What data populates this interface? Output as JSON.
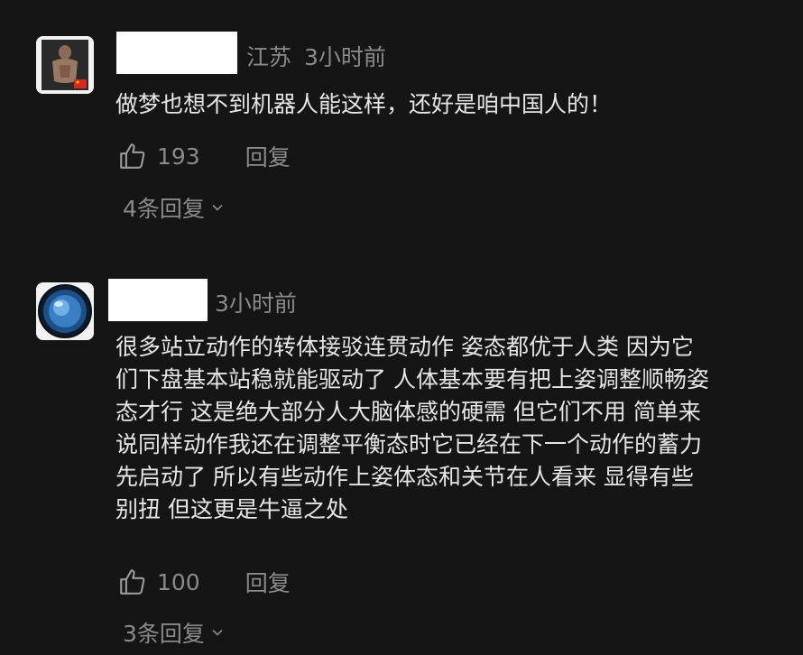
{
  "comments": [
    {
      "location": "江苏",
      "time": "3小时前",
      "text": "做梦也想不到机器人能这样，还好是咱中国人的！",
      "likes": "193",
      "reply_label": "回复",
      "more_replies": "4条回复"
    },
    {
      "location": "",
      "time": "3小时前",
      "text_lines": [
        "很多站立动作的转体接驳连贯动作 姿态都优于人类 因为它",
        "们下盘基本站稳就能驱动了 人体基本要有把上姿调整顺畅姿",
        "态才行 这是绝大部分人大脑体感的硬需 但它们不用 简单来",
        "说同样动作我还在调整平衡态时它已经在下一个动作的蓄力",
        "先启动了 所以有些动作上姿体态和关节在人看来 显得有些",
        "别扭 但这更是牛逼之处"
      ],
      "likes": "100",
      "reply_label": "回复",
      "more_replies": "3条回复"
    }
  ],
  "icons": {
    "like": "thumbs-up-icon",
    "expand": "chevron-down-icon"
  },
  "colors": {
    "background": "#151515",
    "text": "#e6e6e6",
    "muted": "#8a8a8a"
  }
}
